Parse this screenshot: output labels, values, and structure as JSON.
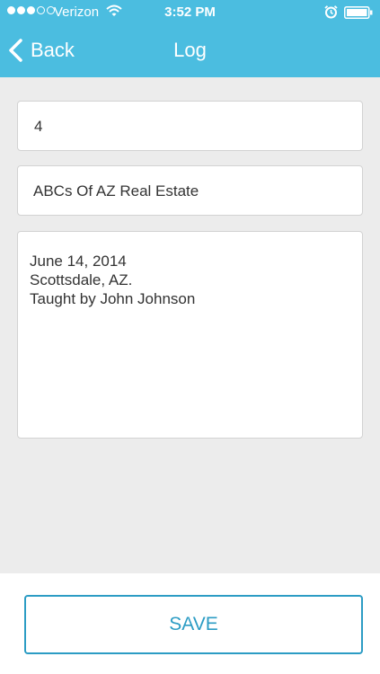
{
  "status_bar": {
    "signal_bars_filled": 3,
    "signal_bars_total": 5,
    "carrier": "Verizon",
    "time": "3:52 PM",
    "icons": [
      "wifi-icon",
      "alarm-icon",
      "battery-icon"
    ]
  },
  "nav": {
    "back_label": "Back",
    "title": "Log",
    "background_color": "#4bbde0"
  },
  "form": {
    "sessions_value": "4",
    "course_value": "ABCs Of AZ Real Estate",
    "notes_lines": [
      "June 14, 2014",
      "Scottsdale, AZ.",
      "Taught by John Johnson"
    ]
  },
  "footer": {
    "save_label": "SAVE",
    "accent_color": "#2c9cc4"
  }
}
